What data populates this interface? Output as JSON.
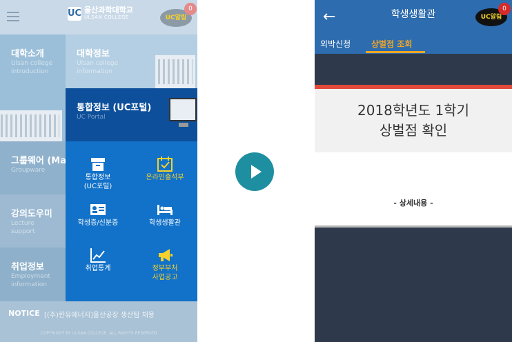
{
  "left_screen": {
    "logo": {
      "mark": "UC",
      "name": "울산과학대학교",
      "english": "ULSAN COLLEGE"
    },
    "alert": {
      "label": "UC알림",
      "count": "0"
    },
    "tiles": [
      {
        "title": "대학소개",
        "subtitle_1": "Ulsan college",
        "subtitle_2": "introduction"
      },
      {
        "title": "대학정보",
        "subtitle_1": "Ulsan college",
        "subtitle_2": "information"
      },
      {
        "title": "그룹웨어 (Ma",
        "subtitle_1": "Groupware",
        "subtitle_2": ""
      },
      {
        "title": "강의도우미",
        "subtitle_1": "Lecture",
        "subtitle_2": "support"
      },
      {
        "title": "취업정보",
        "subtitle_1": "Employment",
        "subtitle_2": "information"
      }
    ],
    "portal": {
      "title": "통합정보 (UC포털)",
      "subtitle": "UC Portal"
    },
    "menu": [
      {
        "label_1": "통합정보",
        "label_2": "(UC포털)",
        "icon": "archive-box-icon"
      },
      {
        "label_1": "온라인출석부",
        "label_2": "",
        "icon": "calendar-check-icon"
      },
      {
        "label_1": "학생증/신분증",
        "label_2": "",
        "icon": "id-card-icon"
      },
      {
        "label_1": "학생생활관",
        "label_2": "",
        "icon": "bed-icon"
      },
      {
        "label_1": "취업통계",
        "label_2": "",
        "icon": "trend-chart-icon"
      },
      {
        "label_1": "정부부처",
        "label_2": "사업공고",
        "icon": "megaphone-icon"
      }
    ],
    "notice": {
      "label": "NOTICE",
      "text": "[(주)한유에너지]울산공장 생산팀 채용"
    },
    "copyright": "COPYRIGHT BY ULSAN COLLEGE. ALL RIGHTS RESERVED"
  },
  "right_screen": {
    "title": "학생생활관",
    "alert": {
      "label": "UC알림",
      "count": "0"
    },
    "tabs": [
      {
        "label": "외박신청"
      },
      {
        "label": "상벌점 조회"
      }
    ],
    "heading_line_1": "2018학년도 1학기",
    "heading_line_2": "상벌점 확인",
    "detail_label": "- 상세내용 -"
  },
  "colors": {
    "left_header": "#c9d9e8",
    "portal_blue": "#0d4f9a",
    "menu_blue": "#1271c8",
    "highlight_yellow": "#f5d22b",
    "right_header": "#2d6cae",
    "tab_orange": "#f5a623",
    "accent_red": "#e14a3a",
    "dark_background": "#2e3a4b",
    "play_button": "#1e8fa0"
  }
}
